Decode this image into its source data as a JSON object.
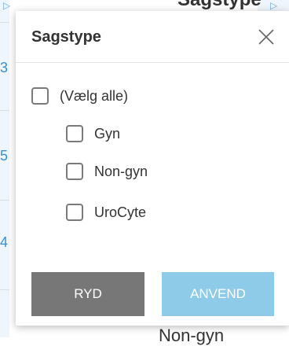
{
  "background": {
    "column_header": "Sagstype",
    "left_values": [
      "3",
      "5",
      "4"
    ],
    "bottom_cell": "Non-gyn"
  },
  "dialog": {
    "title": "Sagstype",
    "close_icon": "close-x-icon",
    "options": [
      {
        "label": "(Vælg alle)",
        "checked": false
      },
      {
        "label": "Gyn",
        "checked": false
      },
      {
        "label": "Non-gyn",
        "checked": false
      },
      {
        "label": "UroCyte",
        "checked": false
      }
    ],
    "buttons": {
      "clear_label": "RYD",
      "apply_label": "ANVEND"
    }
  },
  "colors": {
    "clear_button": "#777777",
    "apply_button": "#8ecbe8",
    "link_blue": "#3d8fcf"
  }
}
